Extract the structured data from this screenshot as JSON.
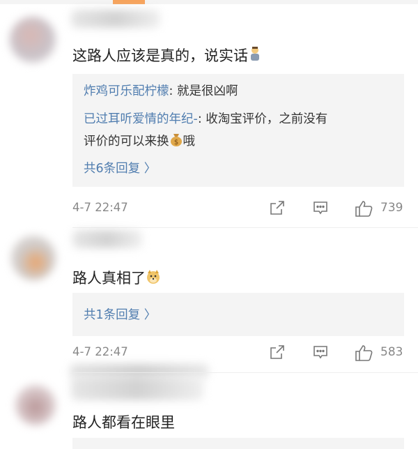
{
  "comments": [
    {
      "text": "这路人应该是真的，说实话",
      "emoji_icon": "person-emoji-icon",
      "replies": [
        {
          "author": "炸鸡可乐配柠檬",
          "sep": ": ",
          "text": "就是很凶啊"
        },
        {
          "author": "已过耳听爱情的年纪-",
          "sep": ": ",
          "text_line1": "收淘宝评价，之前没有",
          "text_line2_before": "评价的可以来换",
          "text_line2_after": "哦",
          "emoji_icon": "money-bag-emoji-icon"
        }
      ],
      "more_replies": "共6条回复 〉",
      "time": "4-7 22:47",
      "likes": "739"
    },
    {
      "text": "路人真相了",
      "emoji_icon": "doge-emoji-icon",
      "more_replies": "共1条回复 〉",
      "time": "4-7 22:47",
      "likes": "583"
    },
    {
      "text": "路人都看在眼里"
    }
  ],
  "colors": {
    "link": "#507daf",
    "meta": "#888888",
    "reply_bg": "#f4f4f4"
  }
}
